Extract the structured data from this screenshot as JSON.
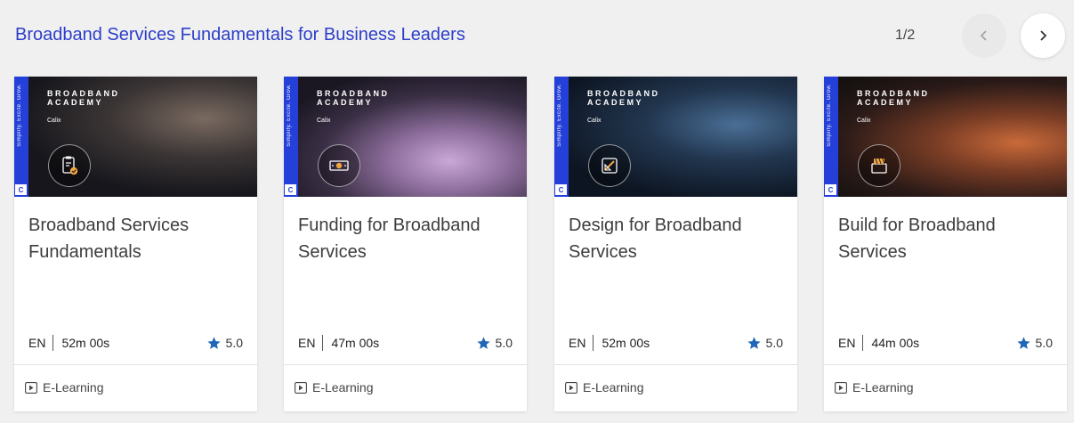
{
  "section": {
    "title": "Broadband Services Fundamentals for Business Leaders",
    "pager": "1/2",
    "prev_icon": "chevron-left-icon",
    "next_icon": "chevron-right-icon"
  },
  "thumbnail": {
    "brand_line1": "BROADBAND",
    "brand_line2": "ACADEMY",
    "partner": "Calix",
    "tagline": "Simplify. Excite. Grow.",
    "corner_mark": "C"
  },
  "colors": {
    "accent_blue": "#2c3ec9",
    "star": "#1f66b8",
    "side_bar": "#2540d8"
  },
  "cards": [
    {
      "title": "Broadband Services Fundamentals",
      "lang": "EN",
      "duration": "52m 00s",
      "rating": "5.0",
      "type": "E-Learning",
      "icon": "clipboard-check-icon"
    },
    {
      "title": "Funding for Broadband Services",
      "lang": "EN",
      "duration": "47m 00s",
      "rating": "5.0",
      "type": "E-Learning",
      "icon": "money-icon"
    },
    {
      "title": "Design for Broadband Services",
      "lang": "EN",
      "duration": "52m 00s",
      "rating": "5.0",
      "type": "E-Learning",
      "icon": "design-tools-icon"
    },
    {
      "title": "Build for Broadband Services",
      "lang": "EN",
      "duration": "44m 00s",
      "rating": "5.0",
      "type": "E-Learning",
      "icon": "construction-icon"
    }
  ]
}
